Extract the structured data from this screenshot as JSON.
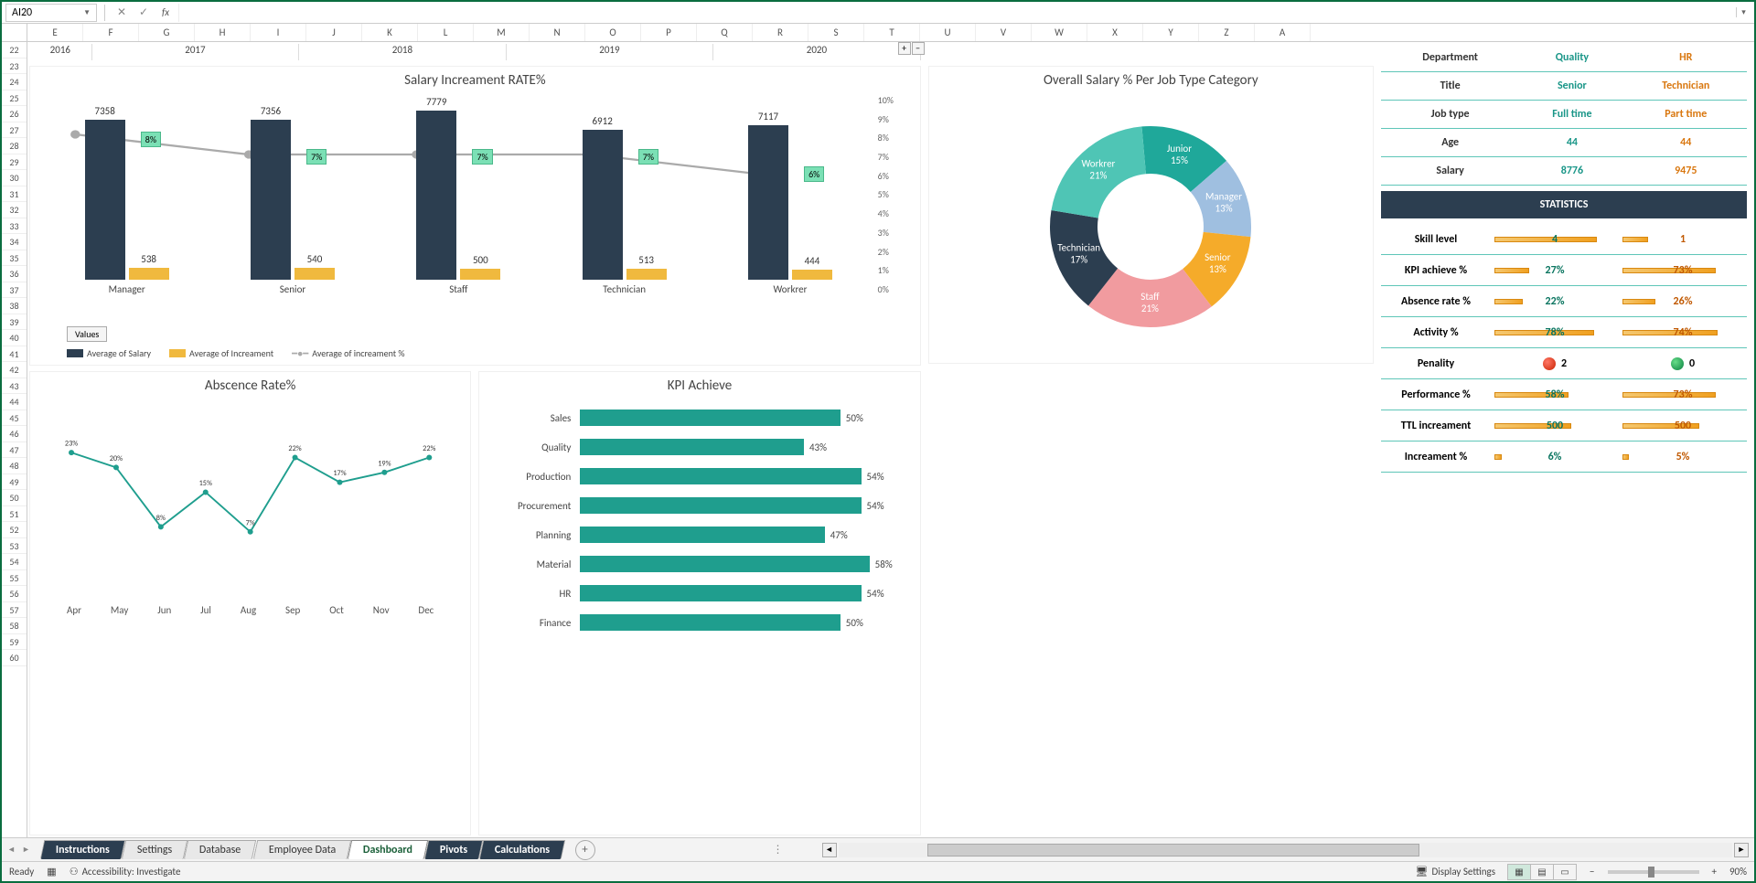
{
  "formula_bar": {
    "cell_ref": "AI20",
    "cancel": "✕",
    "confirm": "✓",
    "fx": "fx",
    "value": ""
  },
  "columns": [
    "E",
    "F",
    "G",
    "H",
    "I",
    "J",
    "K",
    "L",
    "M",
    "N",
    "O",
    "P",
    "Q",
    "R",
    "S",
    "T",
    "U",
    "V",
    "W",
    "X",
    "Y",
    "Z",
    "A"
  ],
  "rows": [
    "22",
    "23",
    "24",
    "25",
    "26",
    "27",
    "28",
    "29",
    "30",
    "31",
    "32",
    "33",
    "34",
    "35",
    "36",
    "37",
    "38",
    "39",
    "40",
    "41",
    "42",
    "43",
    "44",
    "45",
    "46",
    "47",
    "48",
    "49",
    "50",
    "51",
    "52",
    "53",
    "54",
    "55",
    "56",
    "57",
    "58",
    "59",
    "60"
  ],
  "timeline": [
    "2016",
    "2017",
    "2018",
    "2019",
    "2020"
  ],
  "chart_data": [
    {
      "type": "bar",
      "title": "Salary Increament RATE%",
      "categories": [
        "Manager",
        "Senior",
        "Staff",
        "Technician",
        "Workrer"
      ],
      "series": [
        {
          "name": "Average of Salary",
          "values": [
            7358,
            7356,
            7779,
            6912,
            7117
          ]
        },
        {
          "name": "Average of Increament",
          "values": [
            538,
            540,
            500,
            513,
            444
          ]
        },
        {
          "name": "Average of increament %",
          "values": [
            8,
            7,
            7,
            7,
            6
          ]
        }
      ],
      "y2_ticks": [
        "10%",
        "9%",
        "8%",
        "7%",
        "6%",
        "5%",
        "4%",
        "3%",
        "2%",
        "1%",
        "0%"
      ],
      "values_btn": "Values"
    },
    {
      "type": "pie",
      "title": "Overall Salary % Per Job Type Category",
      "slices": [
        {
          "name": "Junior",
          "pct": 15,
          "color": "#1fa89a"
        },
        {
          "name": "Manager",
          "pct": 13,
          "color": "#9fbfe0"
        },
        {
          "name": "Senior",
          "pct": 13,
          "color": "#f5ab2a"
        },
        {
          "name": "Staff",
          "pct": 21,
          "color": "#f19b9f"
        },
        {
          "name": "Technician",
          "pct": 17,
          "color": "#2c3e50"
        },
        {
          "name": "Workrer",
          "pct": 21,
          "color": "#4fc5b5"
        }
      ]
    },
    {
      "type": "line",
      "title": "Abscence Rate%",
      "categories": [
        "Apr",
        "May",
        "Jun",
        "Jul",
        "Aug",
        "Sep",
        "Oct",
        "Nov",
        "Dec"
      ],
      "values": [
        23,
        20,
        8,
        15,
        7,
        22,
        17,
        19,
        22
      ]
    },
    {
      "type": "bar",
      "title": "KPI Achieve",
      "orientation": "horizontal",
      "categories": [
        "Sales",
        "Quality",
        "Production",
        "Procurement",
        "Planning",
        "Material",
        "HR",
        "Finance"
      ],
      "values": [
        50,
        43,
        54,
        54,
        47,
        58,
        54,
        50
      ]
    }
  ],
  "info": {
    "headers": [
      "Department",
      "Title",
      "Job type",
      "Age",
      "Salary"
    ],
    "col1": [
      "Quality",
      "Senior",
      "Full time",
      "44",
      "8776"
    ],
    "col2": [
      "HR",
      "Technician",
      "Part time",
      "44",
      "9475"
    ]
  },
  "stats": {
    "header": "STATISTICS",
    "rows": [
      {
        "label": "Skill level",
        "v1": "4",
        "p1": 80,
        "v2": "1",
        "p2": 20
      },
      {
        "label": "KPI achieve %",
        "v1": "27%",
        "p1": 27,
        "v2": "73%",
        "p2": 73
      },
      {
        "label": "Absence rate %",
        "v1": "22%",
        "p1": 22,
        "v2": "26%",
        "p2": 26
      },
      {
        "label": "Activity %",
        "v1": "78%",
        "p1": 78,
        "v2": "74%",
        "p2": 74
      },
      {
        "label": "Penality",
        "v1": "2",
        "dot1": "red",
        "v2": "0",
        "dot2": "green"
      },
      {
        "label": "Performance %",
        "v1": "58%",
        "p1": 58,
        "v2": "73%",
        "p2": 73
      },
      {
        "label": "TTL increament",
        "v1": "500",
        "p1": 60,
        "v2": "500",
        "p2": 60
      },
      {
        "label": "Increament %",
        "v1": "6%",
        "p1": 6,
        "v2": "5%",
        "p2": 5
      }
    ]
  },
  "tabs": [
    "Instructions",
    "Settings",
    "Database",
    "Employee Data",
    "Dashboard",
    "Pivots",
    "Calculations"
  ],
  "active_tab": "Dashboard",
  "status": {
    "ready": "Ready",
    "accessibility": "Accessibility: Investigate",
    "display": "Display Settings",
    "zoom": "90%"
  }
}
